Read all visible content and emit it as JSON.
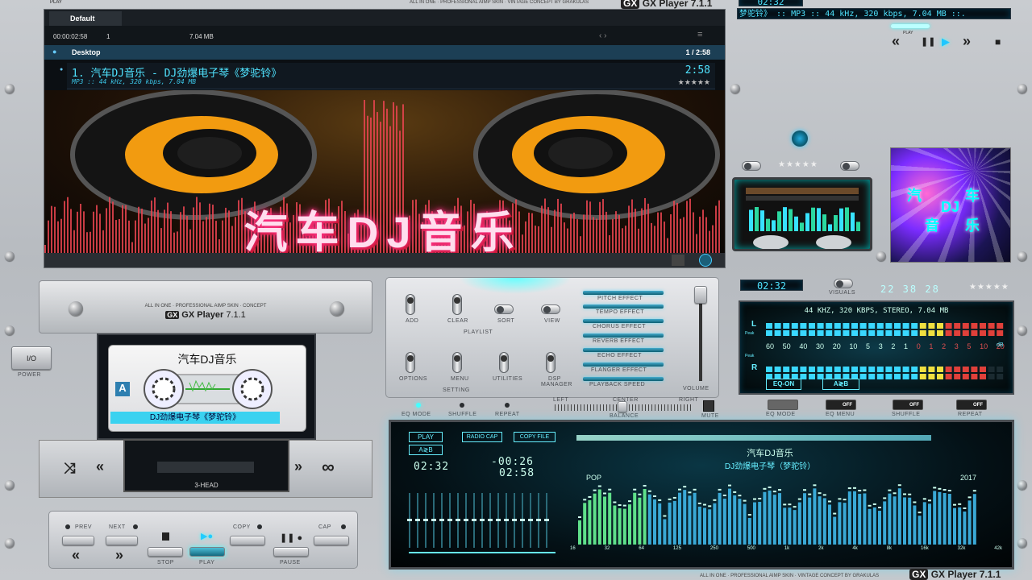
{
  "app": {
    "name": "GX Player",
    "version": "7.1.1",
    "tagline": "ALL IN ONE · PROFESSIONAL AIMP SKIN · CONCEPT",
    "tagline_top": "ALL IN ONE · PROFESSIONAL AIMP SKIN · VINTAGE CONCEPT BY GRAKULAS",
    "tagline_bottom": "ALL IN ONE · PROFESSIONAL AIMP SKIN · VINTAGE CONCEPT BY GRAKULAS"
  },
  "playlist": {
    "play_tab_label": "PLAY",
    "tab": "Default",
    "elapsed": "00:00:02:58",
    "count": "1",
    "size": "7.04 MB",
    "group": "Desktop",
    "group_pos": "1 / 2:58",
    "track_title": "1. 汽车DJ音乐 - DJ劲爆电子琴《梦驼铃》",
    "track_len": "2:58",
    "track_meta": "MP3 :: 44 kHz, 320 kbps, 7.04 MB",
    "rating": "★★★★★"
  },
  "top_right": {
    "time": "02:32",
    "scroll_text": "梦驼铃》 :: MP3 :: 44 kHz, 320 kbps, 7.04 MB ::.",
    "play_label": "PLAY",
    "transport": [
      "«",
      "❚❚",
      "▶",
      "»",
      "■"
    ]
  },
  "album": {
    "lines": [
      "汽",
      "车",
      "DJ",
      "音",
      "乐"
    ]
  },
  "banner_text": "汽车DJ音乐",
  "mini": {
    "stars": "★★★★★"
  },
  "cassette": {
    "brand_line": "ALL IN ONE · PROFESSIONAL AIMP SKIN · CONCEPT",
    "title": "汽车DJ音乐",
    "side": "A",
    "label": "DJ劲爆电子琴《梦驼铃》",
    "head": "3-HEAD",
    "power_label": "POWER",
    "power_btn": "I/O",
    "keys": {
      "prev": "PREV",
      "next": "NEXT",
      "copy": "COPY",
      "cap": "CAP",
      "stop": "STOP",
      "play": "PLAY",
      "pause": "PAUSE"
    }
  },
  "effects": {
    "switches": [
      "ADD",
      "CLEAR",
      "SORT",
      "VIEW",
      "OPTIONS",
      "MENU",
      "UTILITIES",
      "DSP MANAGER"
    ],
    "playlist_label": "PLAYLIST",
    "setting_label": "SETTING",
    "effects": [
      "PITCH EFFECT",
      "TEMPO EFFECT",
      "CHORUS EFFECT",
      "REVERB EFFECT",
      "ECHO EFFECT",
      "FLANGER EFFECT",
      "PLAYBACK SPEED"
    ],
    "volume_label": "VOLUME",
    "bottom": [
      "EQ MODE",
      "SHUFFLE",
      "REPEAT"
    ],
    "balance": [
      "LEFT",
      "CENTER",
      "BALANCE",
      "RIGHT"
    ],
    "mute": "MUTE"
  },
  "meter": {
    "time": "02:32",
    "visuals": "VISUALS",
    "digits": "22 38 28",
    "stars": "★★★★★",
    "info": "44 KHZ, 320 KBPS, STEREO, 7.04 MB",
    "scale": [
      "60",
      "50",
      "40",
      "30",
      "20",
      "10",
      "5",
      "3",
      "2",
      "1",
      "0",
      "1",
      "2",
      "3",
      "5",
      "10",
      "20"
    ],
    "eq_on": "EQ-ON",
    "axb": "A≷B",
    "switches": [
      "EQ MODE",
      "EQ MENU",
      "SHUFFLE",
      "REPEAT"
    ],
    "off": "OFF",
    "peak": "Peak",
    "l": "L",
    "r": "R",
    "db": "dB"
  },
  "display": {
    "play": "PLAY",
    "axb": "A≷B",
    "radio": "RADIO CAP",
    "copy": "COPY FILE",
    "time1": "02:32",
    "time2": "-00:26",
    "time3": "02:58",
    "artist": "汽车DJ音乐",
    "title": "DJ劲爆电子琴（梦驼铃）",
    "genre": "POP",
    "year": "2017",
    "freqs": [
      "16",
      "32",
      "64",
      "125",
      "250",
      "500",
      "1k",
      "2k",
      "4k",
      "8k",
      "16k",
      "32k",
      "42k"
    ]
  }
}
